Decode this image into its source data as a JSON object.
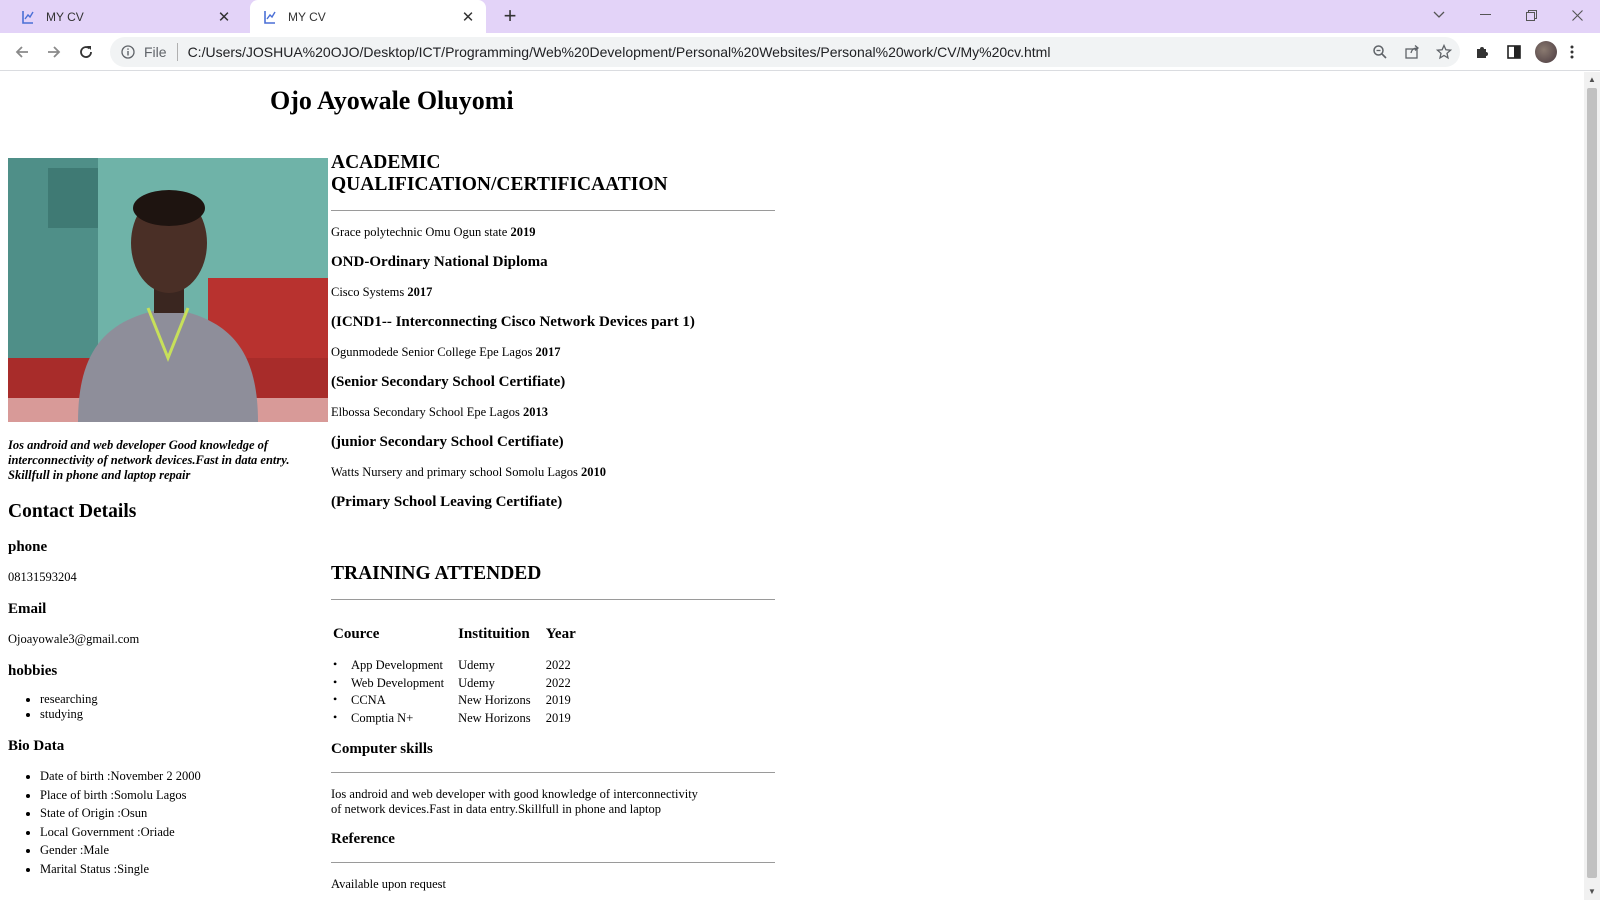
{
  "browser": {
    "tabs": [
      {
        "title": "MY CV",
        "active": false
      },
      {
        "title": "MY CV",
        "active": true
      }
    ],
    "address": {
      "scheme_label": "File",
      "url": "C:/Users/JOSHUA%20OJO/Desktop/ICT/Programming/Web%20Development/Personal%20Websites/Personal%20work/CV/My%20cv.html"
    }
  },
  "cv": {
    "name": "Ojo Ayowale Oluyomi",
    "intro": "Ios android and web developer Good knowledge of interconnectivity of network devices.Fast in data entry. Skillfull in phone and laptop repair",
    "contact_heading": "Contact Details",
    "phone_label": "phone",
    "phone": "08131593204",
    "email_label": "Email",
    "email": "Ojoayowale3@gmail.com",
    "hobbies_label": "hobbies",
    "hobbies": [
      "researching",
      "studying"
    ],
    "bio_label": "Bio Data",
    "bio": [
      "Date of birth :November 2 2000",
      "Place of birth :Somolu Lagos",
      "State of Origin :Osun",
      "Local Government :Oriade",
      "Gender :Male",
      "Marital Status :Single"
    ],
    "academic_heading": "ACADEMIC QUALIFICATION/CERTIFICAATION",
    "academics": [
      {
        "institution": "Grace polytechnic Omu Ogun state",
        "year": "2019",
        "certificate": "OND-Ordinary National Diploma"
      },
      {
        "institution": "Cisco Systems",
        "year": "2017",
        "certificate": "(ICND1-- Interconnecting Cisco Network Devices part 1)"
      },
      {
        "institution": "Ogunmodede Senior College Epe Lagos",
        "year": "2017",
        "certificate": "(Senior Secondary School Certifiate)"
      },
      {
        "institution": "Elbossa Secondary School Epe Lagos",
        "year": "2013",
        "certificate": "(junior Secondary School Certifiate)"
      },
      {
        "institution": "Watts Nursery and primary school Somolu Lagos",
        "year": "2010",
        "certificate": "(Primary School Leaving Certifiate)"
      }
    ],
    "training_heading": "TRAINING ATTENDED",
    "training_columns": [
      "Cource",
      "Instituition",
      "Year"
    ],
    "training_rows": [
      {
        "course": "App Development",
        "institution": "Udemy",
        "year": "2022"
      },
      {
        "course": "Web Development",
        "institution": "Udemy",
        "year": "2022"
      },
      {
        "course": "CCNA",
        "institution": "New Horizons",
        "year": "2019"
      },
      {
        "course": "Comptia N+",
        "institution": "New Horizons",
        "year": "2019"
      }
    ],
    "skills_heading": "Computer skills",
    "skills_text": "Ios android and web developer with good knowledge of interconnectivity of network devices.Fast in data entry.Skillfull in phone and laptop",
    "reference_heading": "Reference",
    "reference_text": "Available upon request"
  }
}
